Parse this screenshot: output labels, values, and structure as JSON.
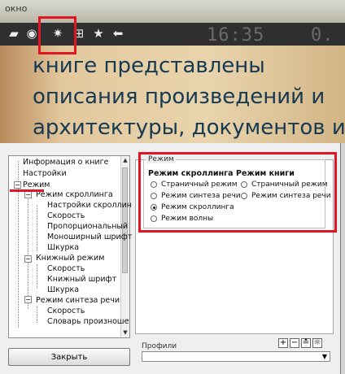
{
  "reader": {
    "title": "окно",
    "time": "16:35",
    "battery": "0.",
    "page_lines": [
      "книге    представлены",
      "описания произведений и",
      "архитектуры, документов и"
    ]
  },
  "toolbar": {
    "icons": [
      "folder-icon",
      "disc-icon",
      "settings-icon",
      "plus-icon",
      "star-icon",
      "back-arrow-icon"
    ]
  },
  "dialog": {
    "close_button": "Закрыть",
    "tree": [
      {
        "label": "Информация о книге",
        "level": 1
      },
      {
        "label": "Настройки",
        "level": 1
      },
      {
        "label": "Режим",
        "level": 1
      },
      {
        "label": "Режим скроллинга",
        "level": 2
      },
      {
        "label": "Настройки скроллин",
        "level": 3
      },
      {
        "label": "Скорость",
        "level": 3
      },
      {
        "label": "Пропорциональный",
        "level": 3
      },
      {
        "label": "Моноширный шрифт",
        "level": 3
      },
      {
        "label": "Шкурка",
        "level": 3
      },
      {
        "label": "Книжный режим",
        "level": 2
      },
      {
        "label": "Скорость",
        "level": 3
      },
      {
        "label": "Книжный шрифт",
        "level": 3
      },
      {
        "label": "Шкурка",
        "level": 3
      },
      {
        "label": "Режим синтеза речи",
        "level": 2
      },
      {
        "label": "Скорость",
        "level": 3
      },
      {
        "label": "Словарь произноше",
        "level": 3
      }
    ],
    "group": {
      "title": "Режим",
      "scroll_heading": "Режим скроллинга",
      "book_heading": "Режим книги",
      "scroll_options": [
        "Страничный режим",
        "Режим синтеза речи",
        "Режим скроллинга",
        "Режим волны"
      ],
      "scroll_selected": 2,
      "book_options": [
        "Страничный режим",
        "Режим синтеза речи"
      ]
    },
    "profiles_label": "Профили",
    "profile_value": "",
    "mini_buttons": [
      "+",
      "−",
      "≛",
      "☼"
    ]
  },
  "colors": {
    "highlight": "#e01622",
    "page_text": "#163a52",
    "toolbar_bg": "#2f2f2f"
  }
}
